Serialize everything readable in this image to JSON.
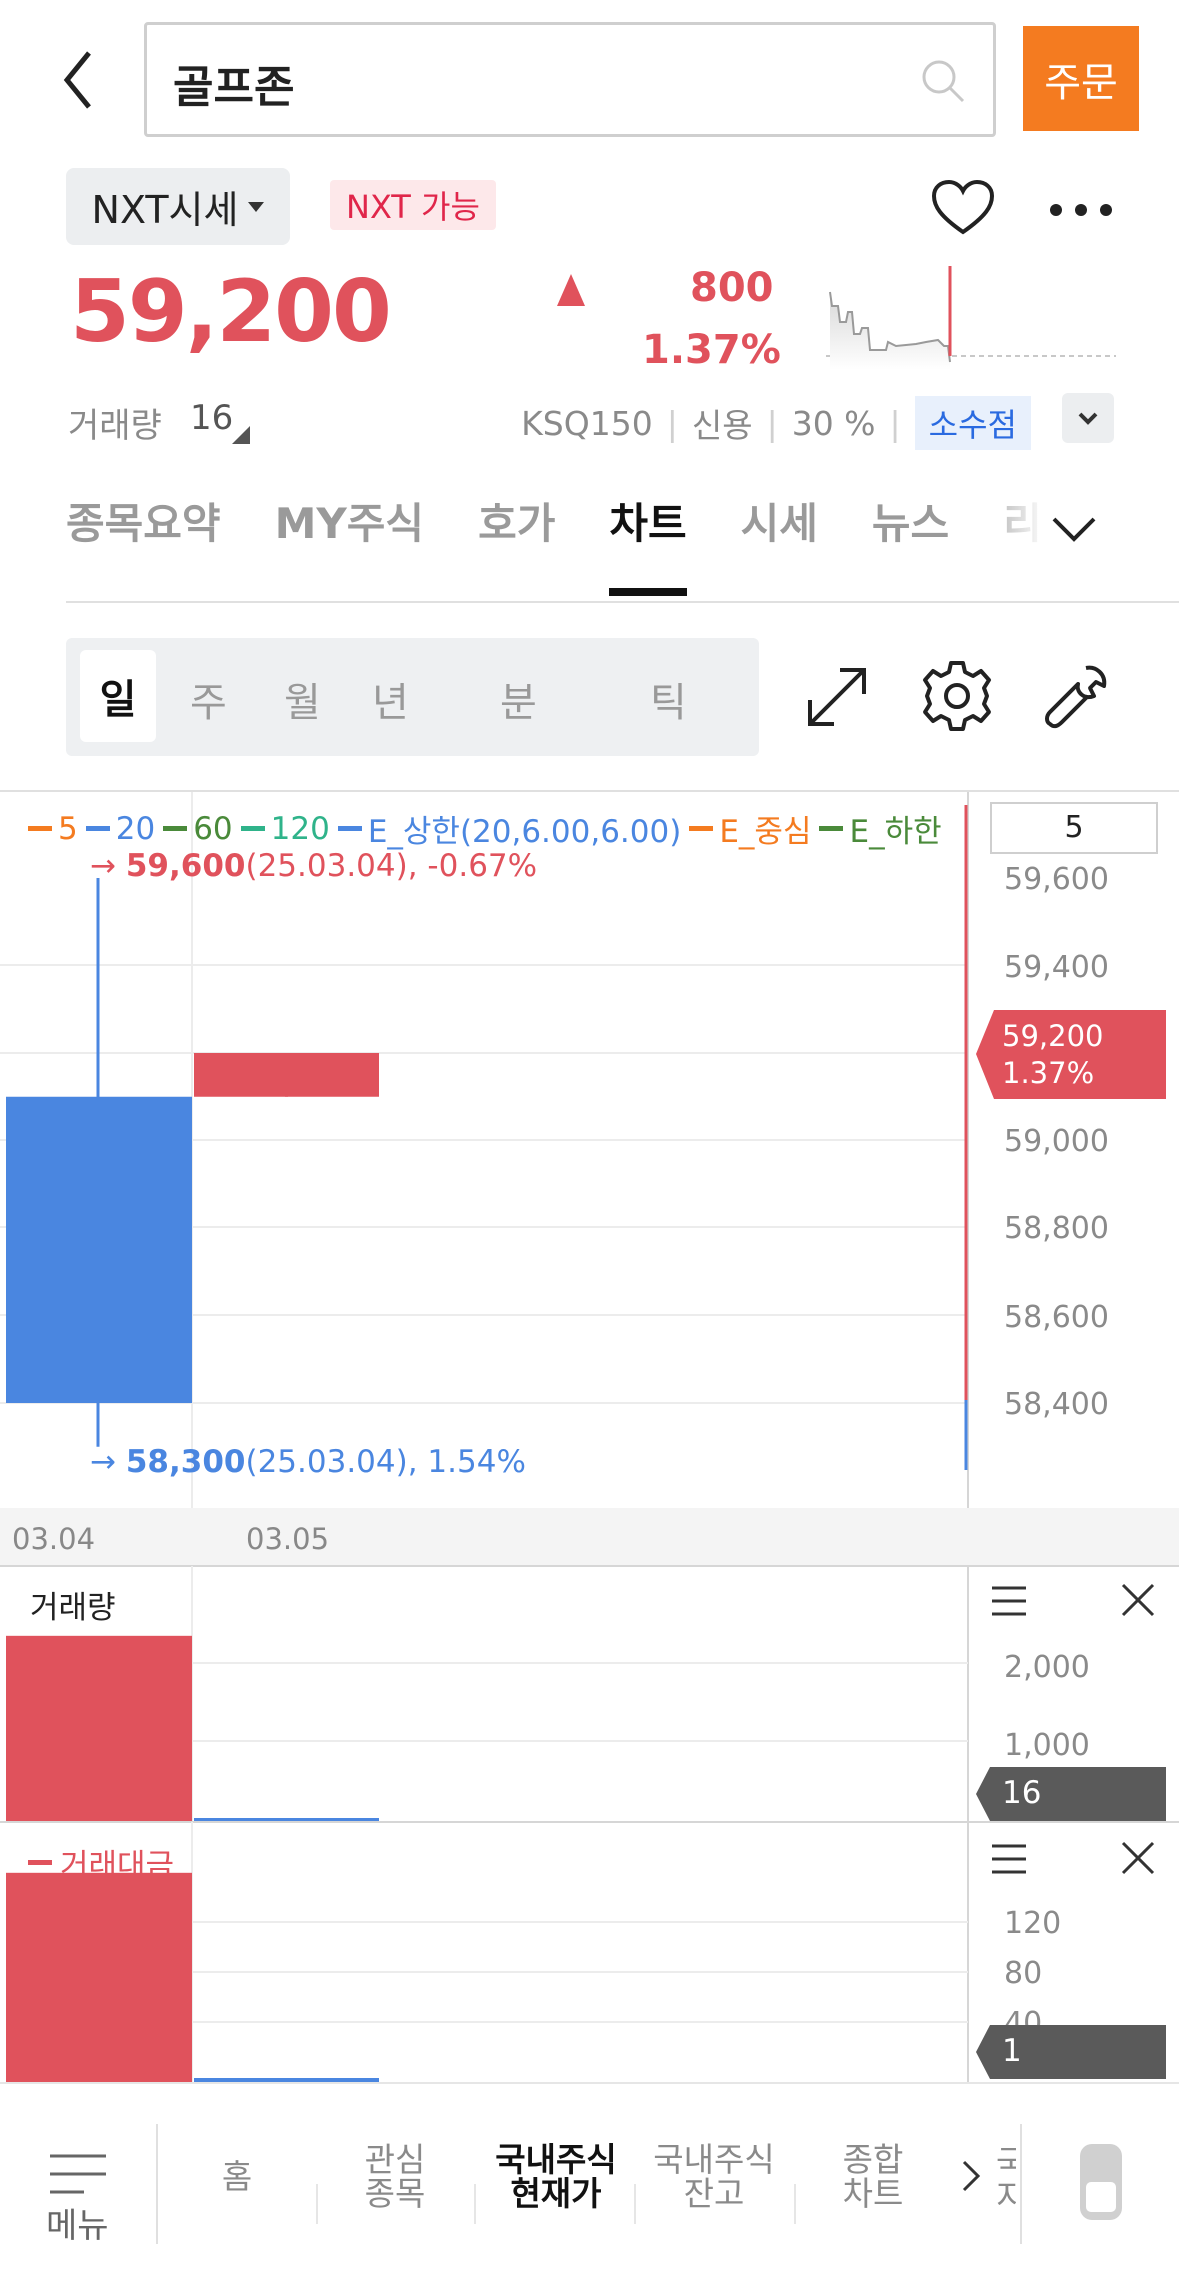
{
  "header": {
    "search_value": "골프존",
    "order_label": "주문"
  },
  "quote": {
    "market_select": "NXT시세",
    "nxt_badge": "NXT 가능",
    "price": "59,200",
    "change": "800",
    "change_pct": "1.37%",
    "volume_label": "거래량",
    "volume_value": "16",
    "index": "KSQ150",
    "credit_label": "신용",
    "credit_value": "30 %",
    "decimal_label": "소수점"
  },
  "tabs": [
    "종목요약",
    "MY주식",
    "호가",
    "차트",
    "시세",
    "뉴스",
    "리"
  ],
  "active_tab": "차트",
  "periods": [
    "일",
    "주",
    "월",
    "년",
    "분",
    "틱"
  ],
  "chart": {
    "legend": [
      {
        "label": "5",
        "color": "#f47b20"
      },
      {
        "label": "20",
        "color": "#4a86e0"
      },
      {
        "label": "60",
        "color": "#4a8a3a"
      },
      {
        "label": "120",
        "color": "#2fb38a"
      },
      {
        "label": "E_상한(20,6.00,6.00)",
        "color": "#4a86e0"
      },
      {
        "label": "E_중심",
        "color": "#f47b20"
      },
      {
        "label": "E_하한",
        "color": "#4a8a3a"
      }
    ],
    "high_value": "59,600",
    "high_detail": "(25.03.04), -0.67%",
    "low_value": "58,300",
    "low_detail": "(25.03.04), 1.54%",
    "period_input": "5",
    "current_tag_price": "59,200",
    "current_tag_pct": "1.37%",
    "volume_title": "거래량",
    "volume_tag": "16",
    "amount_title": "거래대금",
    "amount_tag": "1"
  },
  "chart_data": [
    {
      "type": "candlestick",
      "title": "",
      "x": [
        "03.04",
        "03.05"
      ],
      "candles": [
        {
          "date": "03.04",
          "open": 59100,
          "high": 59600,
          "low": 58300,
          "close": 58400
        },
        {
          "date": "03.05",
          "open": 59100,
          "high": 59200,
          "low": 59100,
          "close": 59200
        }
      ],
      "y_ticks": [
        59600,
        59400,
        59000,
        58800,
        58600,
        58400
      ],
      "ylim": [
        58300,
        59700
      ],
      "current": 59200,
      "grid": true
    },
    {
      "type": "bar",
      "title": "거래량",
      "categories": [
        "03.04",
        "03.05"
      ],
      "values": [
        2400,
        16
      ],
      "y_ticks": [
        2000,
        1000
      ],
      "ylim": [
        0,
        3300
      ]
    },
    {
      "type": "bar",
      "title": "거래대금",
      "categories": [
        "03.04",
        "03.05"
      ],
      "values": [
        150,
        1
      ],
      "y_ticks": [
        120,
        80,
        40
      ],
      "ylim": [
        0,
        185
      ]
    }
  ],
  "bottom_nav": {
    "menu_label": "메뉴",
    "items": [
      {
        "label": "홈"
      },
      {
        "label": "관심\n종목"
      },
      {
        "label": "국내주식\n현재가"
      },
      {
        "label": "국내주식\n잔고"
      },
      {
        "label": "종합\n차트"
      }
    ],
    "cut_label": "국\n지",
    "active_index": 2
  },
  "colors": {
    "up": "#e0525c",
    "down": "#4a86e0",
    "accent": "#f47b20"
  }
}
